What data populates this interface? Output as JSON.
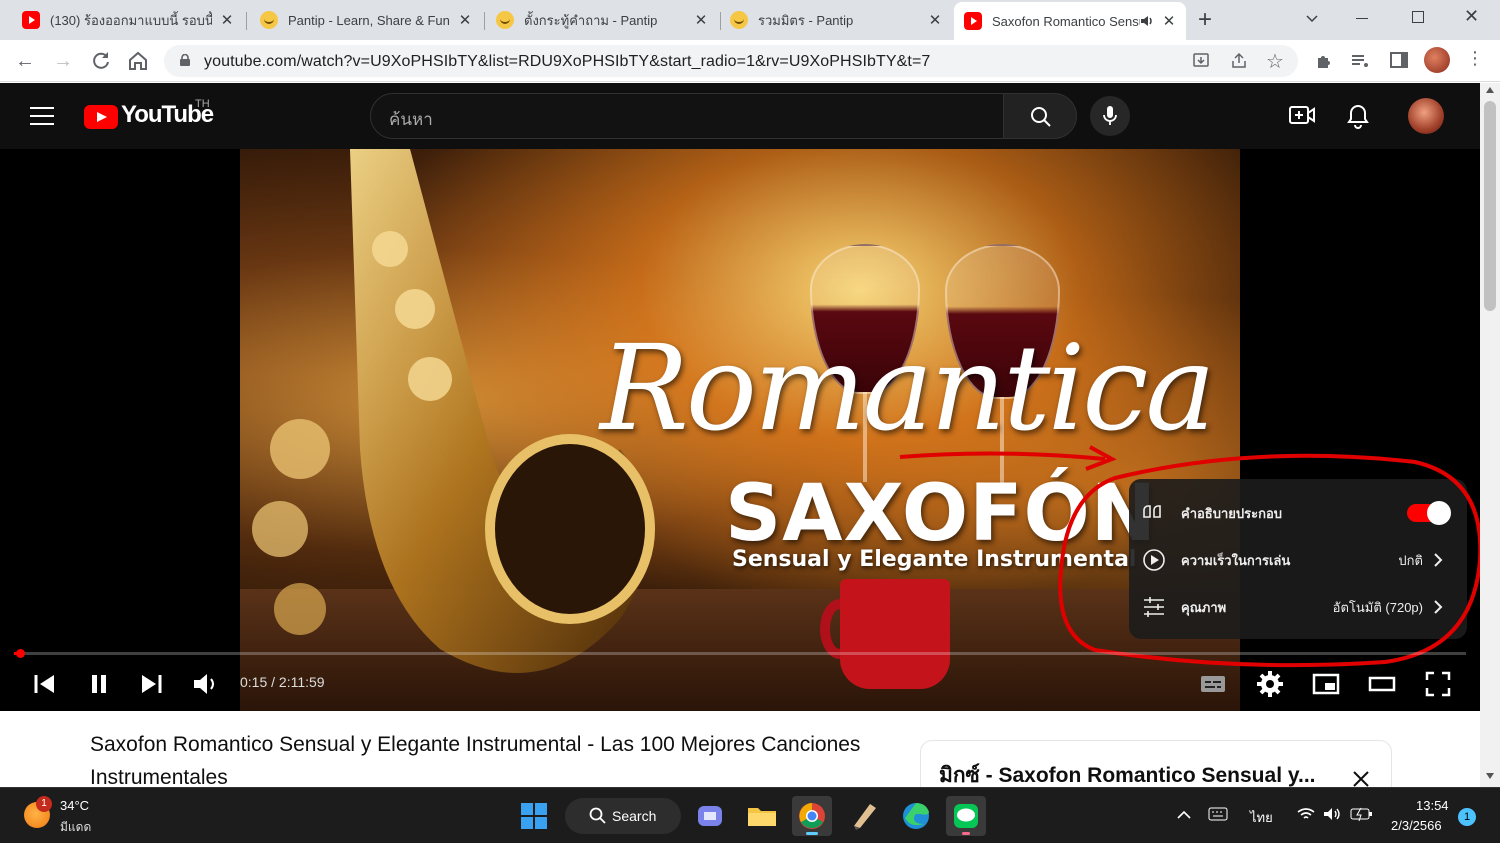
{
  "browser": {
    "tabs": [
      {
        "title": "(130) ร้องออกมาแบบนี้ รอบนี้",
        "icon": "youtube-icon"
      },
      {
        "title": "Pantip - Learn, Share & Fun",
        "icon": "pantip-icon"
      },
      {
        "title": "ตั้งกระทู้คำถาม - Pantip",
        "icon": "pantip-icon"
      },
      {
        "title": "รวมมิตร - Pantip",
        "icon": "pantip-icon"
      },
      {
        "title": "Saxofon Romantico Sensual",
        "icon": "youtube-icon",
        "active": true,
        "audio": true
      }
    ],
    "new_tab": "+",
    "url": "youtube.com/watch?v=U9XoPHSIbTY&list=RDU9XoPHSIbTY&start_radio=1&rv=U9XoPHSIbTY&t=7"
  },
  "youtube": {
    "logo_text": "YouTube",
    "region": "TH",
    "search_placeholder": "ค้นหา"
  },
  "video": {
    "thumb_line1": "Romantica",
    "thumb_line2": "SAXOFÓN",
    "thumb_line3": "Sensual y Elegante Instrumental",
    "time": "0:15 / 2:11:59",
    "progress": 0.0019
  },
  "settings_menu": {
    "items": [
      {
        "label": "คำอธิบายประกอบ",
        "icon": "annotations-icon",
        "toggle": true
      },
      {
        "label": "ความเร็วในการเล่น",
        "icon": "playback-speed-icon",
        "value": "ปกติ"
      },
      {
        "label": "คุณภาพ",
        "icon": "quality-icon",
        "value": "อัตโนมัติ (720p)"
      }
    ]
  },
  "page": {
    "title": "Saxofon Romantico Sensual y Elegante Instrumental - Las 100 Mejores Canciones Instrumentales",
    "mix_title": "มิกซ์ - Saxofon Romantico Sensual y..."
  },
  "taskbar": {
    "weather_temp": "34°C",
    "weather_desc": "มีแดด",
    "weather_badge": "1",
    "search_label": "Search",
    "lang": "ไทย",
    "time": "13:54",
    "date": "2/3/2566",
    "notif_count": "1"
  },
  "colors": {
    "youtube_red": "#ff0000",
    "annotation": "#e00000"
  }
}
